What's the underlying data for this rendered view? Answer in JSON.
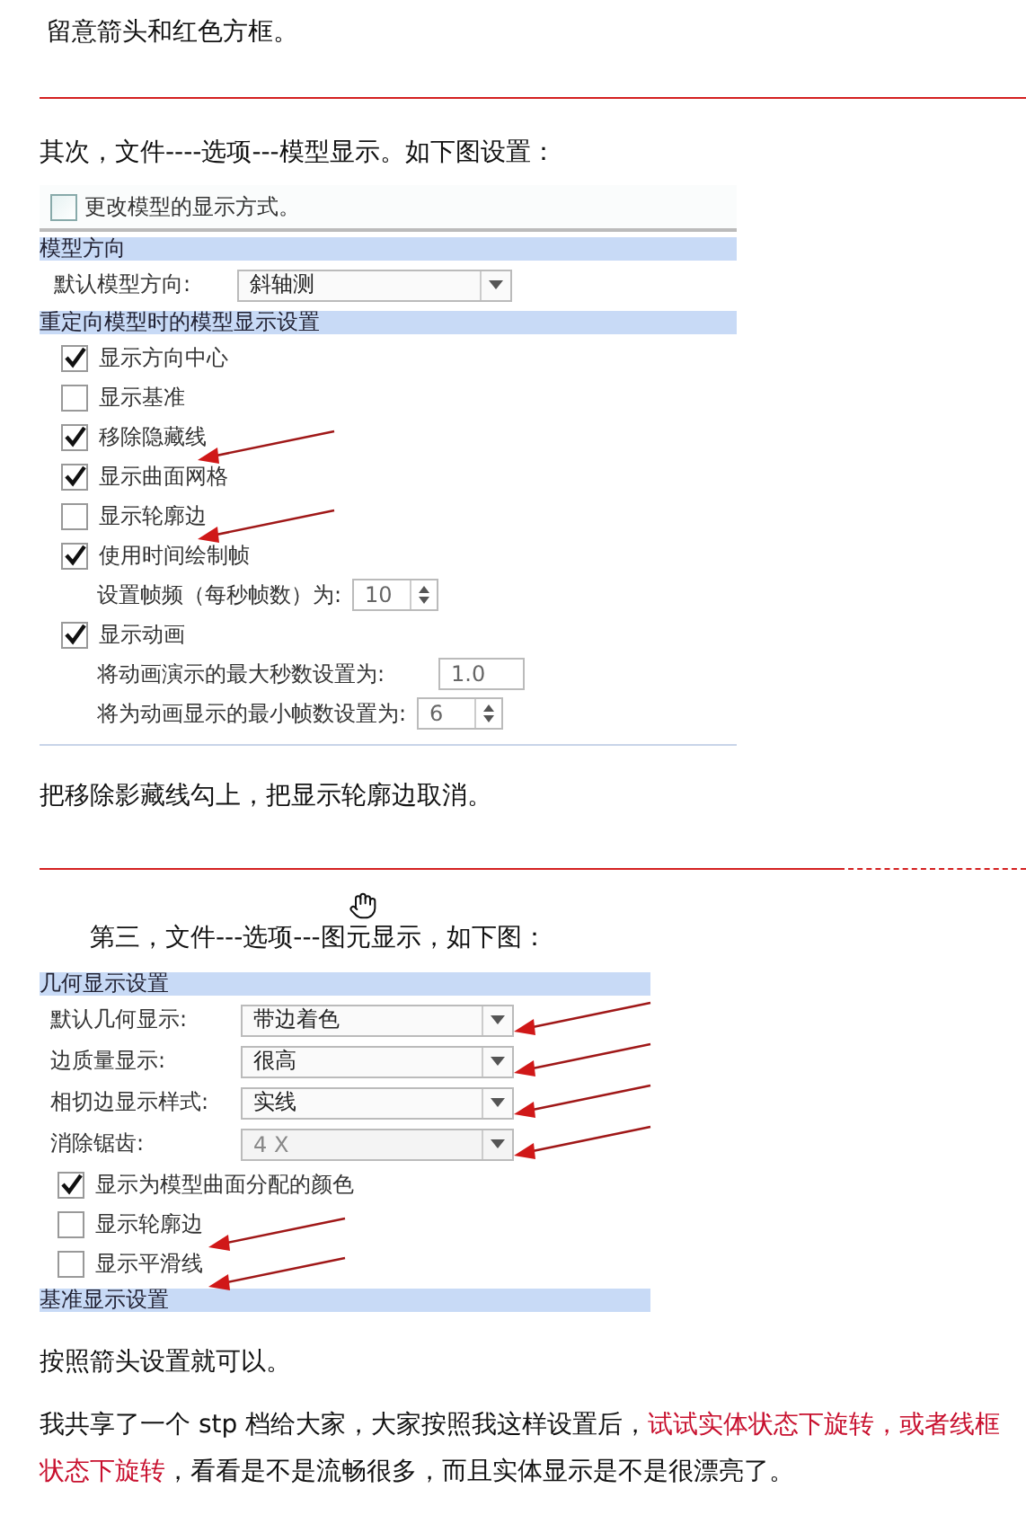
{
  "intro": "留意箭头和红色方框。",
  "step2": "其次，文件----选项---模型显示。如下图设置：",
  "panel1": {
    "top_option": {
      "label": "更改模型的显示方式。",
      "checked": false
    },
    "items": [
      {
        "kind": "header",
        "label": "模型方向"
      },
      {
        "kind": "select",
        "label": "默认模型方向:",
        "value": "斜轴测",
        "disabled": false,
        "arrow": false
      },
      {
        "kind": "header",
        "label": "重定向模型时的模型显示设置"
      },
      {
        "kind": "checkbox",
        "label": "显示方向中心",
        "checked": true,
        "arrow": false
      },
      {
        "kind": "checkbox",
        "label": "显示基准",
        "checked": false,
        "arrow": false
      },
      {
        "kind": "checkbox",
        "label": "移除隐藏线",
        "checked": true,
        "arrow": true
      },
      {
        "kind": "checkbox",
        "label": "显示曲面网格",
        "checked": true,
        "arrow": false
      },
      {
        "kind": "checkbox",
        "label": "显示轮廓边",
        "checked": false,
        "arrow": true
      },
      {
        "kind": "checkbox",
        "label": "使用时间绘制帧",
        "checked": true,
        "arrow": false
      },
      {
        "kind": "spinner",
        "label": "设置帧频（每秒帧数）为:",
        "value": "10"
      },
      {
        "kind": "checkbox",
        "label": "显示动画",
        "checked": true,
        "arrow": false
      },
      {
        "kind": "field",
        "label": "将动画演示的最大秒数设置为:",
        "value": "1.0"
      },
      {
        "kind": "spinner",
        "label": "将为动画显示的最小帧数设置为:",
        "value": "6"
      }
    ]
  },
  "caption1": "把移除影藏线勾上，把显示轮廓边取消。",
  "step3": "第三，文件---选项---图元显示，如下图：",
  "panel2": {
    "items": [
      {
        "kind": "header",
        "label": "几何显示设置"
      },
      {
        "kind": "select",
        "label": "默认几何显示:",
        "value": "带边着色",
        "disabled": false,
        "arrow": true
      },
      {
        "kind": "select",
        "label": "边质量显示:",
        "value": "很高",
        "disabled": false,
        "arrow": true
      },
      {
        "kind": "select",
        "label": "相切边显示样式:",
        "value": "实线",
        "disabled": false,
        "arrow": true
      },
      {
        "kind": "select",
        "label": "消除锯齿:",
        "value": "4 X",
        "disabled": true,
        "arrow": true
      },
      {
        "kind": "checkbox",
        "label": "显示为模型曲面分配的颜色",
        "checked": true,
        "arrow": false
      },
      {
        "kind": "checkbox",
        "label": "显示轮廓边",
        "checked": false,
        "arrow": true
      },
      {
        "kind": "checkbox",
        "label": "显示平滑线",
        "checked": false,
        "arrow": true
      },
      {
        "kind": "header",
        "label": "基准显示设置"
      }
    ]
  },
  "caption2": "按照箭头设置就可以。",
  "closing": [
    {
      "kind": "plain",
      "text": "我共享了一个 stp 档给大家，大家按照我这样设置后，"
    },
    {
      "kind": "highlight",
      "text": "试试实体状态下旋转，或者线框状态下旋转"
    },
    {
      "kind": "plain",
      "text": "，看看是不是流畅很多，而且实体显示是不是很漂亮了。"
    }
  ]
}
